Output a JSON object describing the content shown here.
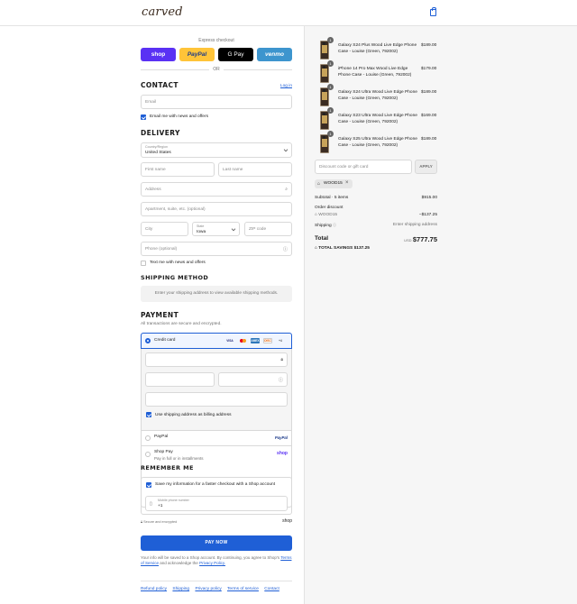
{
  "brand": {
    "logo": "carved"
  },
  "express": {
    "label": "Express checkout",
    "buttons": [
      "shop",
      "PayPal",
      "G Pay",
      "venmo"
    ],
    "or": "OR"
  },
  "contact": {
    "title": "CONTACT",
    "login": "Log in",
    "email_placeholder": "Email",
    "news_label": "Email me with news and offers"
  },
  "delivery": {
    "title": "DELIVERY",
    "country_label": "Country/Region",
    "country_value": "United States",
    "first_name": "First name",
    "last_name": "Last name",
    "address": "Address",
    "apartment": "Apartment, suite, etc. (optional)",
    "city": "City",
    "state_label": "State",
    "state_value": "Iowa",
    "zip": "ZIP code",
    "phone": "Phone (optional)",
    "text_label": "Text me with news and offers"
  },
  "shipping": {
    "title": "SHIPPING METHOD",
    "notice": "Enter your shipping address to view available shipping methods."
  },
  "payment": {
    "title": "PAYMENT",
    "subtitle": "All transactions are secure and encrypted.",
    "credit_card": "Credit card",
    "card_icons": [
      "VISA",
      "MC",
      "AMEX",
      "DISC",
      "+4"
    ],
    "billing_label": "Use shipping address as billing address",
    "paypal": "PayPal",
    "paypal_logo": "PayPal",
    "shop_pay": "Shop Pay",
    "shop_pay_sub": "Pay in full or in installments",
    "shop_logo": "shop"
  },
  "remember": {
    "title": "REMEMBER ME",
    "save_label": "Save my information for a faster checkout with a Shop account",
    "phone_label": "Mobile phone number",
    "phone_value": "+1",
    "secure": "Secure and encrypted",
    "shop_logo": "shop"
  },
  "pay_button": "PAY NOW",
  "terms": {
    "text": "Your info will be saved to a Shop account. By continuing, you agree to Shop's",
    "tos": "Terms of Service",
    "and": "and acknowledge the",
    "privacy": "Privacy Policy."
  },
  "footer": [
    "Refund policy",
    "Shipping",
    "Privacy policy",
    "Terms of service",
    "Contact"
  ],
  "cart": {
    "items": [
      {
        "qty": "1",
        "name": "Galaxy S24 Plus Wood Live Edge Phone Case - Louise (Green, 792002)",
        "price": "$189.00"
      },
      {
        "qty": "1",
        "name": "iPhone 14 Pro Max Wood Live Edge Phone Case - Louise (Green, 792002)",
        "price": "$179.00"
      },
      {
        "qty": "1",
        "name": "Galaxy S24 Ultra Wood Live Edge Phone Case - Louise (Green, 792002)",
        "price": "$189.00"
      },
      {
        "qty": "1",
        "name": "Galaxy S23 Ultra Wood Live Edge Phone Case - Louise (Green, 792002)",
        "price": "$169.00"
      },
      {
        "qty": "1",
        "name": "Galaxy S25 Ultra Wood Live Edge Phone Case - Louise (Green, 792002)",
        "price": "$189.00"
      }
    ],
    "discount_placeholder": "Discount code or gift card",
    "apply": "APPLY",
    "code_tag": "WOOD15",
    "subtotal_label": "Subtotal · 5 items",
    "subtotal_value": "$915.00",
    "order_discount": "Order discount",
    "discount_code": "WOOD15",
    "discount_value": "−$137.25",
    "shipping_label": "Shipping",
    "shipping_value": "Enter shipping address",
    "total_label": "Total",
    "currency": "USD",
    "total_value": "$777.75",
    "savings_label": "TOTAL SAVINGS",
    "savings_value": "$137.25"
  },
  "colors": {
    "accent": "#1f5fd6",
    "shop": "#5a31f4",
    "paypal": "#ffc439",
    "venmo": "#3d95ce"
  }
}
